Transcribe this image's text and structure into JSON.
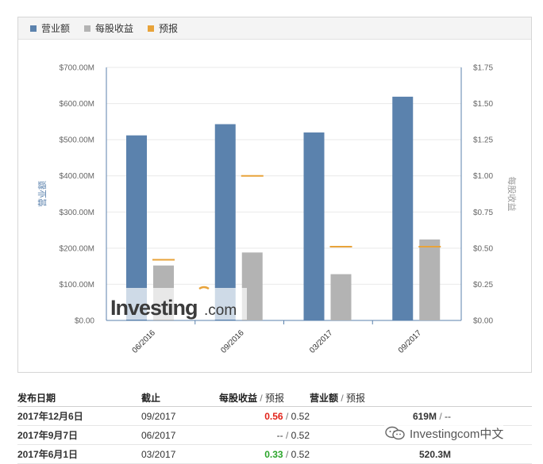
{
  "legend": [
    {
      "label": "营业额",
      "color": "#5b82ad"
    },
    {
      "label": "每股收益",
      "color": "#b3b3b3"
    },
    {
      "label": "预报",
      "color": "#e8a33a"
    }
  ],
  "chart_data": {
    "type": "bar",
    "categories": [
      "06/2016",
      "09/2016",
      "03/2017",
      "09/2017"
    ],
    "series": [
      {
        "name": "营业额",
        "axis": "left",
        "values": [
          512,
          543,
          520,
          619
        ]
      },
      {
        "name": "每股收益",
        "axis": "right",
        "values": [
          0.38,
          0.47,
          0.32,
          0.56
        ]
      },
      {
        "name": "预报",
        "axis": "right",
        "style": "marker",
        "values": [
          0.42,
          1.0,
          0.51,
          0.51
        ]
      }
    ],
    "y_left": {
      "label": "营业额",
      "range": [
        0,
        700
      ],
      "ticks": [
        "$0.00",
        "$100.00M",
        "$200.00M",
        "$300.00M",
        "$400.00M",
        "$500.00M",
        "$600.00M",
        "$700.00M"
      ]
    },
    "y_right": {
      "label": "每股收益",
      "range": [
        0,
        1.75
      ],
      "ticks": [
        "$0.00",
        "$0.25",
        "$0.50",
        "$0.75",
        "$1.00",
        "$1.25",
        "$1.50",
        "$1.75"
      ]
    },
    "grid": true,
    "legend_position": "top-left"
  },
  "watermark": {
    "main": "Investing",
    "suffix": ".com"
  },
  "table": {
    "headers": {
      "date": "发布日期",
      "period_end": "截止",
      "eps": "每股收益",
      "eps_forecast": "预报",
      "revenue": "营业额",
      "revenue_forecast": "预报",
      "sep": "/"
    },
    "rows": [
      {
        "date": "2017年12月6日",
        "period_end": "09/2017",
        "eps": "0.56",
        "eps_forecast": "0.52",
        "revenue": "619M",
        "revenue_forecast": "--"
      },
      {
        "date": "2017年9月7日",
        "period_end": "06/2017",
        "eps": "--",
        "eps_forecast": "0.52",
        "revenue": "",
        "revenue_forecast": ""
      },
      {
        "date": "2017年6月1日",
        "period_end": "03/2017",
        "eps": "0.33",
        "eps_forecast": "0.52",
        "revenue": "520.3M",
        "revenue_forecast": ""
      }
    ]
  },
  "wechat_overlay": {
    "text": "Investingcom中文"
  }
}
